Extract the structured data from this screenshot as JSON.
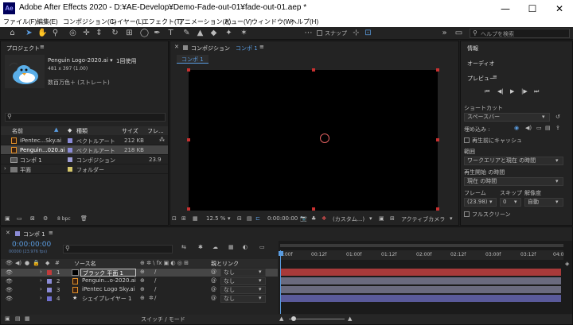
{
  "window": {
    "app_icon": "Ae",
    "title": "Adobe After Effects 2020 - D:¥AE-Develop¥Demo-Fade-out-01¥fade-out-01.aep *",
    "min": "—",
    "max": "☐",
    "close": "✕"
  },
  "menu": [
    "ファイル(F)",
    "編集(E)",
    "コンポジション(C)",
    "レイヤー(L)",
    "エフェクト(T)",
    "アニメーション(A)",
    "ビュー(V)",
    "ウィンドウ(W)",
    "ヘルプ(H)"
  ],
  "toolbar": {
    "snap_label": "スナップ",
    "search_placeholder": "ヘルプを検索"
  },
  "project": {
    "tab": "プロジェクト",
    "asset_name": "Penguin Logo-2020.ai ▾",
    "usage": "1回使用",
    "dims": "481 x 397 (1.00)",
    "color": "数百万色＋ (ストレート)",
    "search_placeholder": "",
    "headers": {
      "name": "名前",
      "type": "種類",
      "size": "サイズ",
      "frame": "フレ..."
    },
    "items": [
      {
        "name": "iPentec...Sky.ai",
        "type": "ベクトルアート",
        "size": "212 KB",
        "frame": "",
        "color": "#8b8bd6",
        "icon": "ai-file-icon"
      },
      {
        "name": "Penguin...020.ai",
        "type": "ベクトルアート",
        "size": "218 KB",
        "frame": "",
        "color": "#8b8bd6",
        "icon": "ai-file-icon"
      },
      {
        "name": "コンポ 1",
        "type": "コンポジション",
        "size": "",
        "frame": "23.9",
        "color": "#9d9dd6",
        "icon": "composition-icon"
      },
      {
        "name": "平面",
        "type": "フォルダー",
        "size": "",
        "frame": "",
        "color": "#d6c86b",
        "icon": "folder-icon"
      }
    ],
    "bpc": "8 bpc"
  },
  "composition": {
    "tab": "コンポジション",
    "tab_link": "コンポ 1",
    "sub_tab": "コンポ 1",
    "zoom": "12.5 %",
    "timecode": "0:00:00:00",
    "view_mode": "(カスタム...)",
    "camera": "アクティブカメラ"
  },
  "right_panel": {
    "info": "情報",
    "audio": "オーディオ",
    "preview": "プレビュー",
    "shortcut_label": "ショートカット",
    "shortcut_value": "スペースバー",
    "embed_label": "埋め込み :",
    "cache_label": "再生前にキャッシュ",
    "range_label": "範囲",
    "range_value": "ワークエリアと現在 の時間",
    "start_label": "再生開始 の時間",
    "start_value": "現在 の時間",
    "frame_label": "フレーム",
    "skip_label": "スキップ",
    "res_label": "解像度",
    "frame_value": "(23.98)",
    "skip_value": "0",
    "res_value": "自動",
    "fullscreen_label": "フルスクリーン"
  },
  "timeline": {
    "tab": "コンポ 1",
    "timecode": "0:00:00:00",
    "fps": "00000 (23.976 fps)",
    "search_placeholder": "",
    "source_header": "ソース名",
    "parent_header": "親とリンク",
    "ruler": [
      "0:00f",
      "00:12f",
      "01:00f",
      "01:12f",
      "02:00f",
      "02:12f",
      "03:00f",
      "03:12f",
      "04:0"
    ],
    "layers": [
      {
        "num": "1",
        "name": "ブラック 平面 1",
        "parent": "なし",
        "label": "#c23b3b",
        "bar": "#a83a3a",
        "selected": true
      },
      {
        "num": "2",
        "name": "Penguin...o-2020.ai",
        "parent": "なし",
        "label": "#8b8bd6",
        "bar": "#6a6a7e",
        "selected": false
      },
      {
        "num": "3",
        "name": "iPentec Logo Sky.ai",
        "parent": "なし",
        "label": "#8b8bd6",
        "bar": "#6a6a7e",
        "selected": false
      },
      {
        "num": "4",
        "name": "シェイプレイヤー 1",
        "parent": "なし",
        "label": "#6f6fcf",
        "bar": "#5a5a9a",
        "selected": false
      }
    ],
    "switch_mode": "スイッチ / モード"
  }
}
